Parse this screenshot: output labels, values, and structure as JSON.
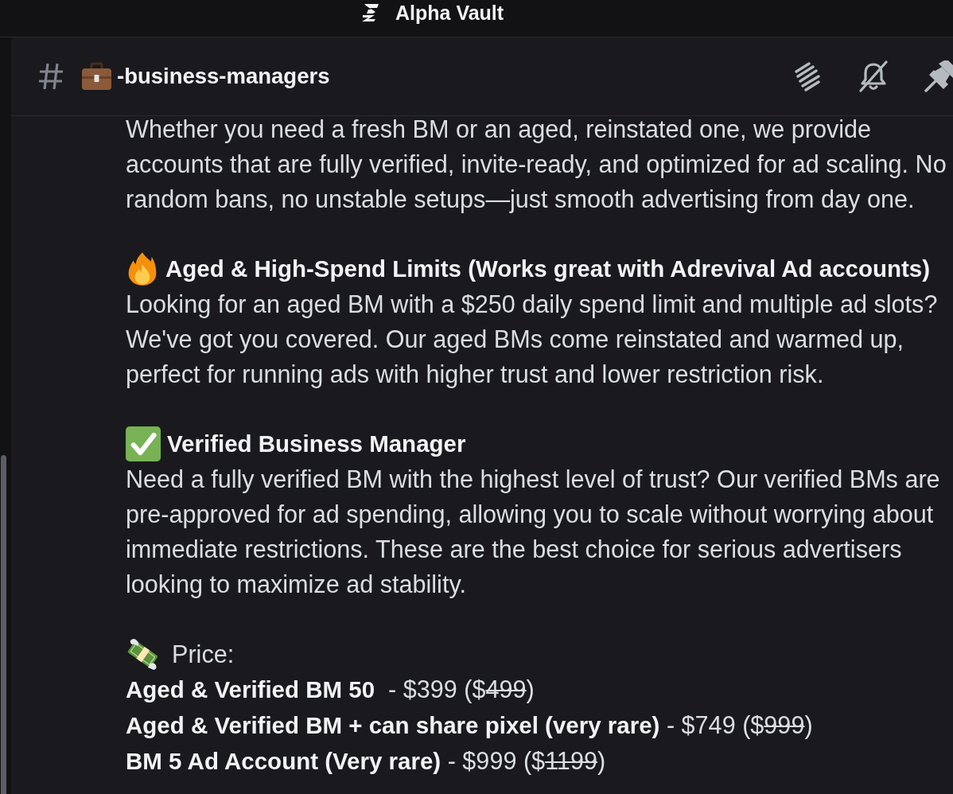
{
  "app_bar": {
    "title": "Alpha Vault"
  },
  "channel_header": {
    "name": "-business-managers"
  },
  "message": {
    "blocks": [
      {
        "kind": "paragraph",
        "text": "Whether you need a fresh BM or an aged, reinstated one, we provide\naccounts that are fully verified, invite-ready, and optimized for ad scaling. No\nrandom bans, no unstable setups—just smooth advertising from day one."
      },
      {
        "kind": "heading",
        "text": "Aged & High-Spend Limits (Works great with Adrevival Ad accounts)"
      },
      {
        "kind": "paragraph",
        "text": "Looking for an aged BM with a $250 daily spend limit and multiple ad slots?\nWe've got you covered. Our aged BMs come reinstated and warmed up,\nperfect for running ads with higher trust and lower restriction risk."
      },
      {
        "kind": "heading",
        "text": "Verified Business Manager"
      },
      {
        "kind": "paragraph",
        "text": "Need a fully verified BM with the highest level of trust? Our verified BMs are\npre-approved for ad spending, allowing you to scale without worrying about\nimmediate restrictions. These are the best choice for serious advertisers\nlooking to maximize ad stability."
      },
      {
        "kind": "label",
        "text": "Price:"
      },
      {
        "kind": "price",
        "item": "Aged & Verified BM 50",
        "price": "  - $399 ($",
        "old_price": "499",
        "suffix": ")"
      },
      {
        "kind": "price",
        "item": "Aged & Verified BM + can share pixel (very rare)",
        "price": " - $749 ($",
        "old_price": "999",
        "suffix": ")"
      },
      {
        "kind": "price",
        "item": "BM 5 Ad Account (Very rare)",
        "price": " - $999 ($",
        "old_price": "1199",
        "suffix": ")"
      }
    ]
  }
}
